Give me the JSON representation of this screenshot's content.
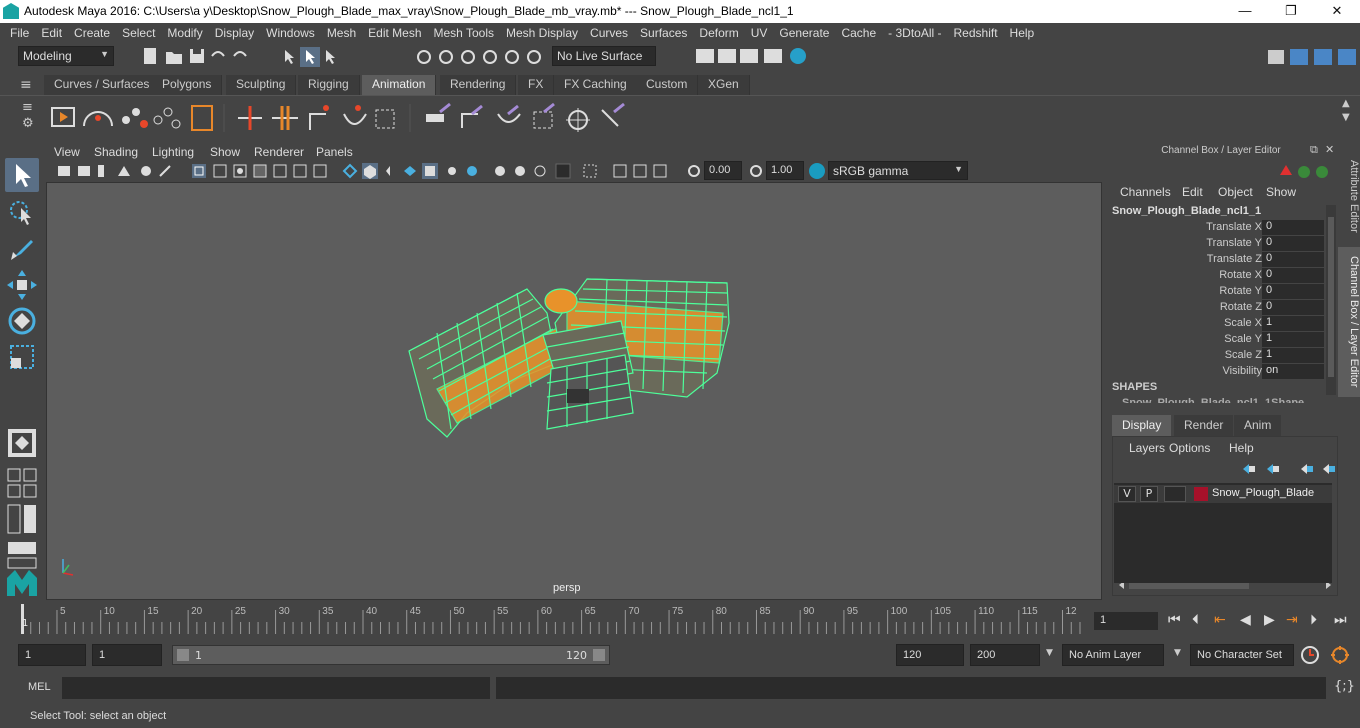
{
  "window": {
    "title": "Autodesk Maya 2016: C:\\Users\\a y\\Desktop\\Snow_Plough_Blade_max_vray\\Snow_Plough_Blade_mb_vray.mb*   ---   Snow_Plough_Blade_ncl1_1",
    "minimize": "—",
    "maximize": "❐",
    "close": "✕"
  },
  "menubar": [
    "File",
    "Edit",
    "Create",
    "Select",
    "Modify",
    "Display",
    "Windows",
    "Mesh",
    "Edit Mesh",
    "Mesh Tools",
    "Mesh Display",
    "Curves",
    "Surfaces",
    "Deform",
    "UV",
    "Generate",
    "Cache",
    "- 3DtoAll -",
    "Redshift",
    "Help"
  ],
  "statusline": {
    "mode": "Modeling",
    "live_surface": "No Live Surface"
  },
  "shelf_tabs": [
    "Curves / Surfaces",
    "Polygons",
    "Sculpting",
    "Rigging",
    "Animation",
    "Rendering",
    "FX",
    "FX Caching",
    "Custom",
    "XGen"
  ],
  "active_shelf_tab": "Animation",
  "panel_menu": [
    "View",
    "Shading",
    "Lighting",
    "Show",
    "Renderer",
    "Panels"
  ],
  "view_toolbar": {
    "exposure": "0.00",
    "gamma": "1.00",
    "colorspace": "sRGB gamma"
  },
  "viewport": {
    "camera": "persp"
  },
  "channel_box": {
    "header": "Channel Box / Layer Editor",
    "menu": [
      "Channels",
      "Edit",
      "Object",
      "Show"
    ],
    "object_name": "Snow_Plough_Blade_ncl1_1",
    "attributes": [
      {
        "label": "Translate X",
        "value": "0"
      },
      {
        "label": "Translate Y",
        "value": "0"
      },
      {
        "label": "Translate Z",
        "value": "0"
      },
      {
        "label": "Rotate X",
        "value": "0"
      },
      {
        "label": "Rotate Y",
        "value": "0"
      },
      {
        "label": "Rotate Z",
        "value": "0"
      },
      {
        "label": "Scale X",
        "value": "1"
      },
      {
        "label": "Scale Y",
        "value": "1"
      },
      {
        "label": "Scale Z",
        "value": "1"
      },
      {
        "label": "Visibility",
        "value": "on"
      }
    ],
    "shapes_label": "SHAPES",
    "shape_name": "Snow_Plough_Blade_ncl1_1Shape"
  },
  "layer_editor": {
    "tabs": [
      "Display",
      "Render",
      "Anim"
    ],
    "active_tab": "Display",
    "menu": [
      "Layers",
      "Options",
      "Help"
    ],
    "layer": {
      "v": "V",
      "p": "P",
      "name": "Snow_Plough_Blade",
      "color": "#a6112a"
    }
  },
  "side_tabs": [
    "Attribute Editor",
    "Channel Box / Layer Editor"
  ],
  "timeline": {
    "ticks": [
      "5",
      "10",
      "15",
      "20",
      "25",
      "30",
      "35",
      "40",
      "45",
      "50",
      "55",
      "60",
      "65",
      "70",
      "75",
      "80",
      "85",
      "90",
      "95",
      "100",
      "105",
      "110",
      "115",
      "12"
    ],
    "current_frame_marker": "1",
    "current_frame": "1"
  },
  "range": {
    "start": "1",
    "playback_start": "1",
    "slider_start": "1",
    "slider_end": "120",
    "playback_end": "120",
    "end": "200",
    "anim_layer": "No Anim Layer",
    "character_set": "No Character Set"
  },
  "command_line": {
    "label": "MEL"
  },
  "help_line": "Select Tool: select an object"
}
